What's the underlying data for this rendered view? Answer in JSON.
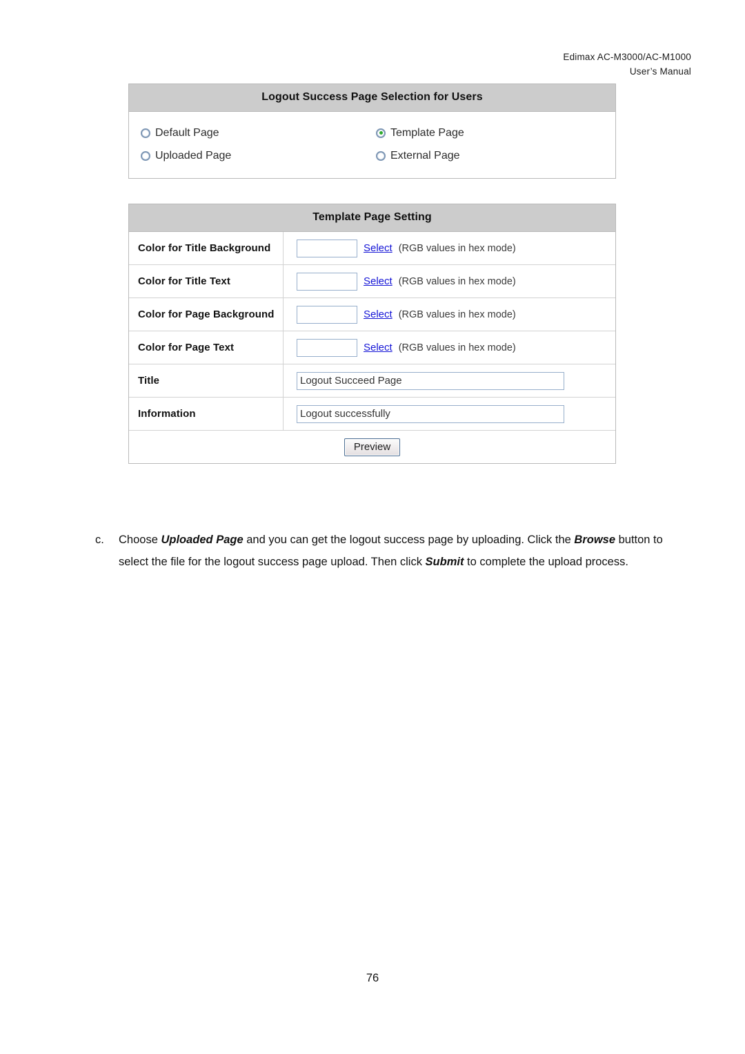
{
  "document_header": {
    "line1": "Edimax  AC-M3000/AC-M1000",
    "line2": "User’s  Manual"
  },
  "selection_panel": {
    "title": "Logout Success Page Selection for Users",
    "options": [
      {
        "label": "Default Page",
        "checked": false
      },
      {
        "label": "Template Page",
        "checked": true
      },
      {
        "label": "Uploaded Page",
        "checked": false
      },
      {
        "label": "External Page",
        "checked": false
      }
    ],
    "selected": "Template Page",
    "checked_color": "#2faa2f",
    "ring_color": "#7d96b4"
  },
  "template_panel": {
    "title": "Template Page Setting",
    "select_link_label": "Select",
    "hex_hint": "(RGB values in hex mode)",
    "rows": [
      {
        "label": "Color for Title Background",
        "value": "",
        "type": "color"
      },
      {
        "label": "Color for Title Text",
        "value": "",
        "type": "color"
      },
      {
        "label": "Color for Page Background",
        "value": "",
        "type": "color"
      },
      {
        "label": "Color for Page Text",
        "value": "",
        "type": "color"
      },
      {
        "label": "Title",
        "value": "Logout Succeed Page",
        "type": "text"
      },
      {
        "label": "Information",
        "value": "Logout successfully",
        "type": "text"
      }
    ],
    "preview_button_label": "Preview",
    "link_color": "#1414d6",
    "header_bg": "#cccccc",
    "input_border": "#96aecb"
  },
  "instruction": {
    "marker": "c.",
    "segment_1": "Choose ",
    "emphasis_1": "Uploaded Page",
    "segment_2": " and you can get the logout success page by uploading. Click the ",
    "emphasis_2": "Browse",
    "segment_3": " button to select the file for the logout success page upload. Then click ",
    "emphasis_3": "Submit",
    "segment_4": " to complete the upload process."
  },
  "footer": {
    "page_number": "76"
  }
}
